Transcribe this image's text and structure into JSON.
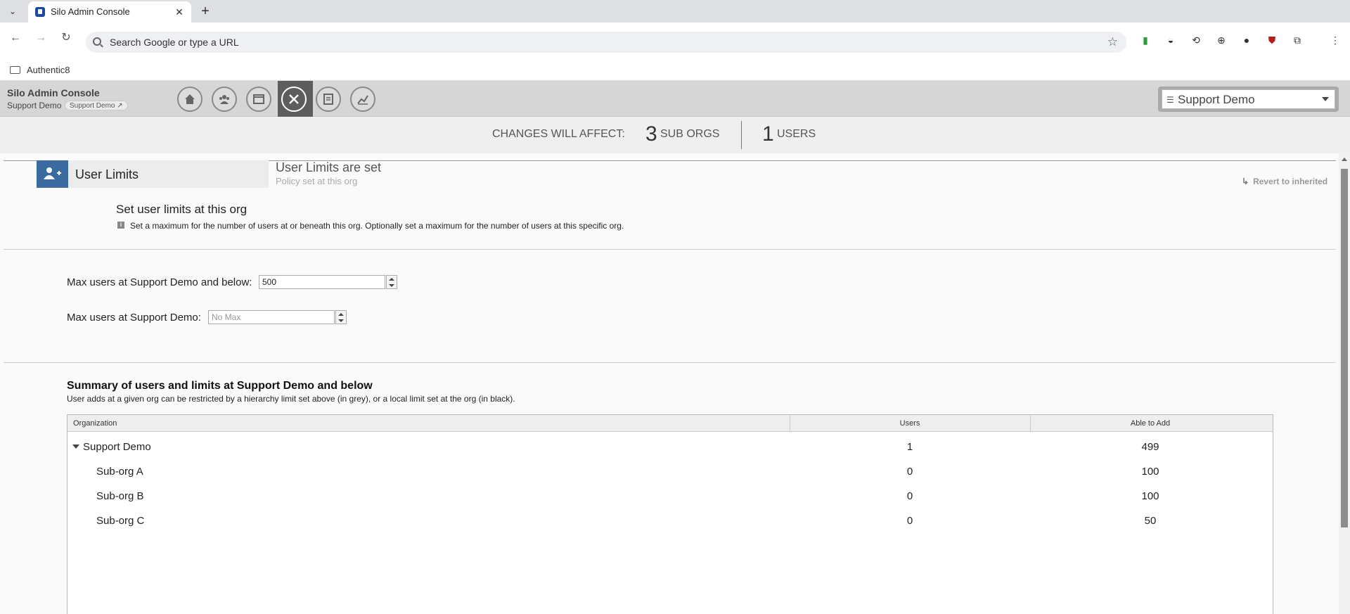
{
  "browser": {
    "tab_title": "Silo Admin Console",
    "omnibox_placeholder": "Search Google or type a URL",
    "bookmark_folder": "Authentic8",
    "extension_icons": [
      "signal-bars-icon",
      "half-circle-icon",
      "sync-icon",
      "globe-icon",
      "account-icon",
      "shield-ublock-icon",
      "puzzle-icon",
      "kebab-menu-icon"
    ]
  },
  "app": {
    "title": "Silo Admin Console",
    "org_name": "Support Demo",
    "org_pill": "Support Demo",
    "nav_items": [
      "home",
      "users",
      "window",
      "tools",
      "reports",
      "analytics"
    ],
    "active_nav": "tools",
    "org_selector": "Support Demo"
  },
  "changes": {
    "label": "CHANGES WILL AFFECT:",
    "sub_orgs_count": "3",
    "sub_orgs_label": "SUB ORGS",
    "users_count": "1",
    "users_label": "USERS"
  },
  "policy": {
    "name": "User Limits",
    "status": "User Limits are set",
    "status_sub": "Policy set at this org",
    "revert_label": "Revert to inherited",
    "section_title": "Set user limits at this org",
    "info_text": "Set a maximum for the number of users at or beneath this org. Optionally set a maximum for the number of users at this specific org.",
    "max_below_label": "Max users at Support Demo and below:",
    "max_below_value": "500",
    "max_at_label": "Max users at Support Demo:",
    "max_at_placeholder": "No Max"
  },
  "summary": {
    "title": "Summary of users and limits at Support Demo and below",
    "desc": "User adds at a given org can be restricted by a hierarchy limit set above (in grey), or a local limit set at the org (in black).",
    "columns": [
      "Organization",
      "Users",
      "Able to Add"
    ],
    "rows": [
      {
        "org": "Support Demo",
        "users": "1",
        "able": "499"
      },
      {
        "org": "Sub-org A",
        "users": "0",
        "able": "100"
      },
      {
        "org": "Sub-org B",
        "users": "0",
        "able": "100"
      },
      {
        "org": "Sub-org C",
        "users": "0",
        "able": "50"
      }
    ]
  }
}
